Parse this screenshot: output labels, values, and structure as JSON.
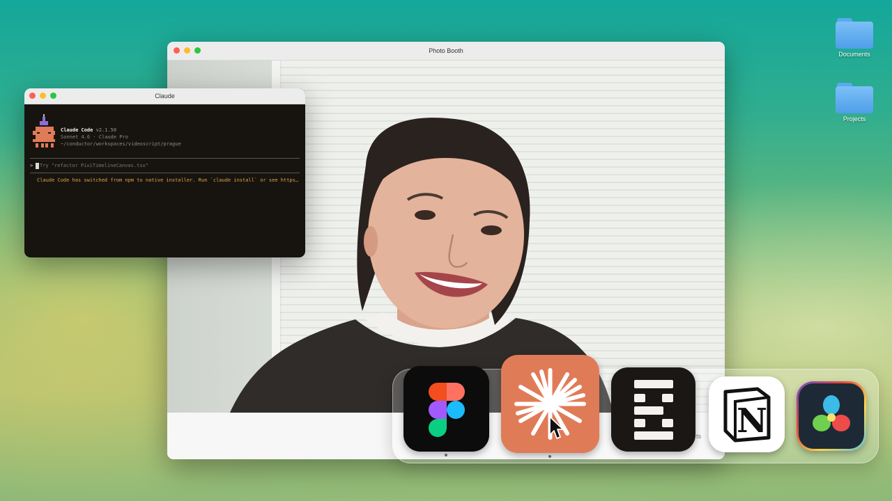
{
  "desktop": {
    "icons": [
      {
        "label": "Documents",
        "icon": "folder-icon"
      },
      {
        "label": "Projects",
        "icon": "folder-icon"
      }
    ]
  },
  "photo_booth": {
    "title": "Photo Booth",
    "effects_label": "ts"
  },
  "claude_window": {
    "title": "Claude",
    "app_name": "Claude Code",
    "version": "v2.1.50",
    "model": "Sonnet 4.6 · Claude Pro",
    "path": "~/conductor/workspaces/videoscript/prague",
    "prompt_symbol": ">",
    "input_placeholder": "Try \"refactor PixiTimelineCanvas.tsx\"",
    "notice": "Claude Code has switched from npm to native installer. Run `claude install` or see https://…"
  },
  "dock": {
    "apps": [
      {
        "name": "Figma",
        "icon": "figma-icon"
      },
      {
        "name": "Claude",
        "icon": "claude-burst-icon"
      },
      {
        "name": "Conductor",
        "icon": "conductor-icon"
      },
      {
        "name": "Notion",
        "icon": "notion-icon",
        "letter": "N"
      },
      {
        "name": "DaVinci Resolve",
        "icon": "davinci-resolve-icon"
      }
    ]
  },
  "colors": {
    "terminal_bg": "#17140f",
    "claude_accent": "#e07b57",
    "notice_text": "#e0a24d"
  }
}
